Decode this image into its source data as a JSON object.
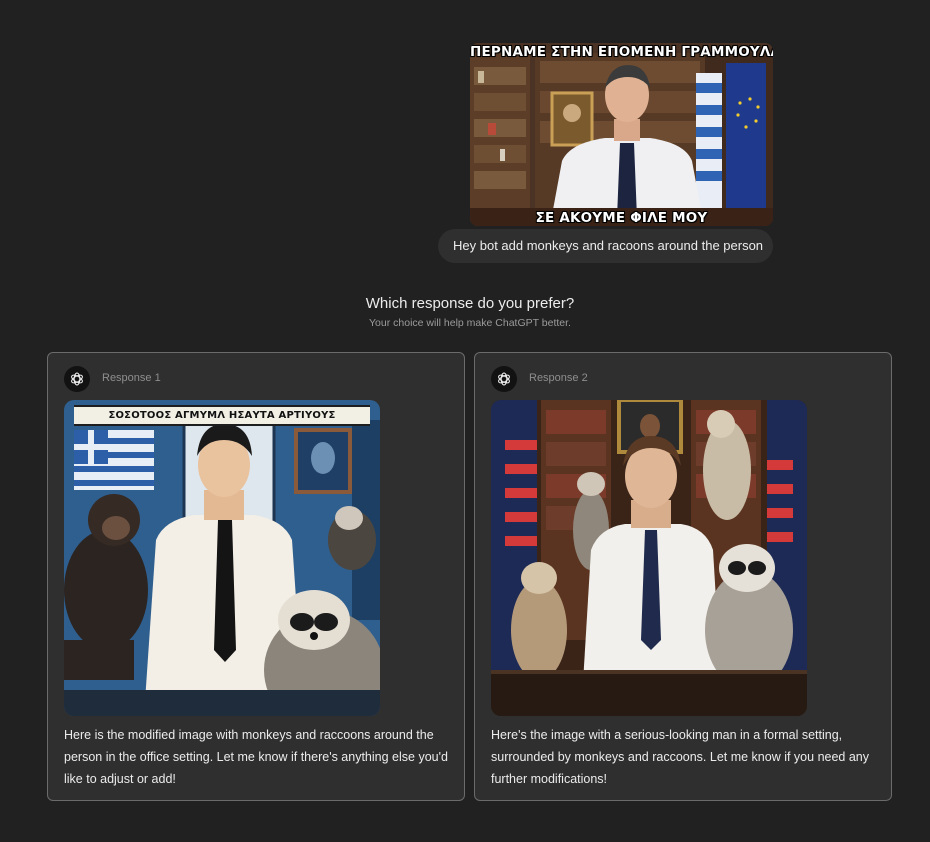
{
  "user_message": {
    "image": {
      "caption_top": "ΠΕΡΝΑΜΕ ΣΤΗΝ ΕΠΟΜΕΝΗ ΓΡΑΜΜΟΥΛΑ",
      "caption_bottom": "ΣΕ ΑΚΟΥΜΕ ΦΙΛΕ ΜΟΥ"
    },
    "text": "Hey bot add monkeys and racoons  around the person"
  },
  "preference": {
    "title": "Which response do you prefer?",
    "subtitle": "Your choice will help make ChatGPT better."
  },
  "responses": [
    {
      "label": "Response 1",
      "image_banner": "ΣΟΣΟΤΟΟΣ ΑΓΜΥΜΛ ΗΣΑΥΤΑ ΑΡΤΙΥΟΥΣ",
      "text": "Here is the modified image with monkeys and raccoons around the person in the office setting. Let me know if there's anything else you'd like to adjust or add!"
    },
    {
      "label": "Response 2",
      "text": "Here's the image with a serious-looking man in a formal setting, surrounded by monkeys and raccoons. Let me know if you need any further modifications!"
    }
  ],
  "icons": {
    "assistant_avatar": "openai-logo-icon"
  },
  "colors": {
    "background": "#212121",
    "bubble": "#2f2f2f",
    "card_border": "#6b6b6b"
  }
}
